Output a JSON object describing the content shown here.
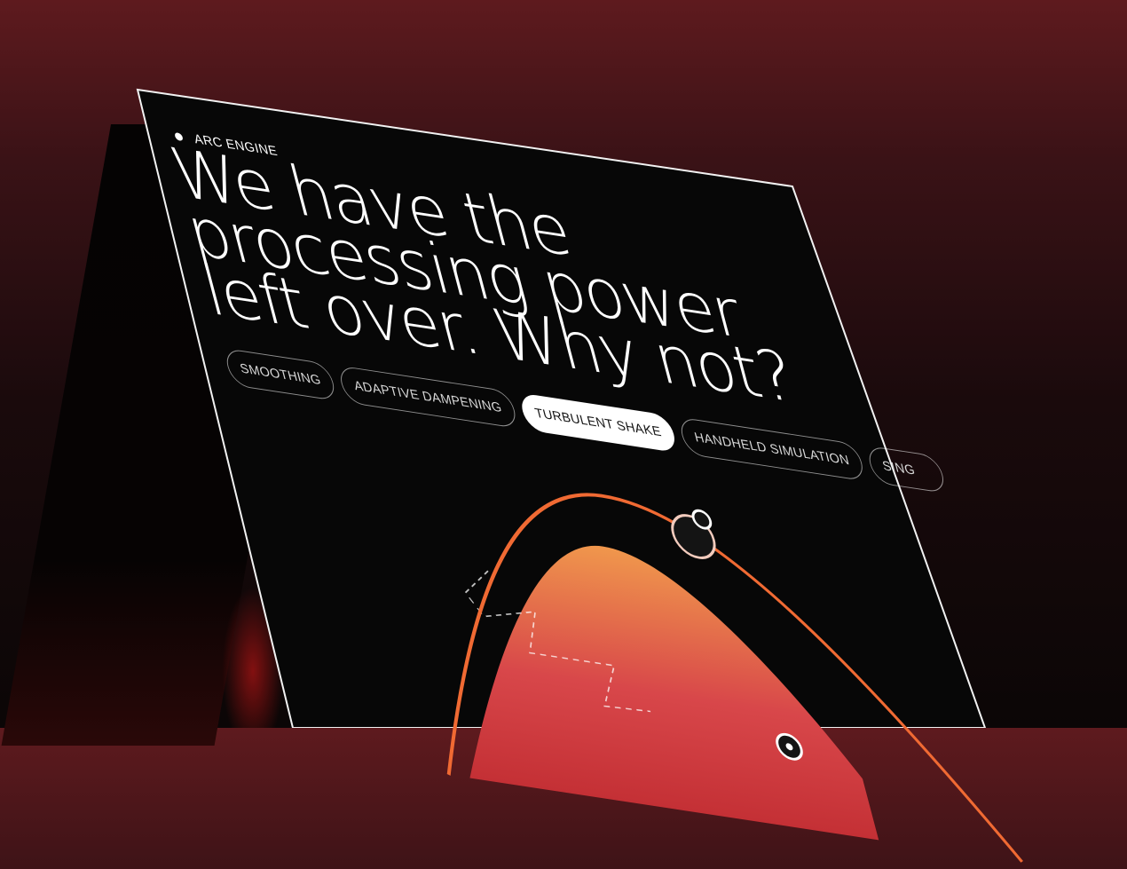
{
  "brand": {
    "label": "ARC ENGINE"
  },
  "headline": "We have the\nprocessing power\nleft over. Why not?",
  "modes": [
    {
      "label": "SMOOTHING",
      "active": false
    },
    {
      "label": "ADAPTIVE DAMPENING",
      "active": false
    },
    {
      "label": "TURBULENT SHAKE",
      "active": true
    },
    {
      "label": "HANDHELD SIMULATION",
      "active": false
    },
    {
      "label": "SING",
      "active": false
    }
  ],
  "colors": {
    "background_top": "#5e1a1e",
    "panel": "#070707",
    "accent_curve": "#f06a33",
    "fill_top": "#f0974c",
    "fill_bottom": "#c43035"
  }
}
